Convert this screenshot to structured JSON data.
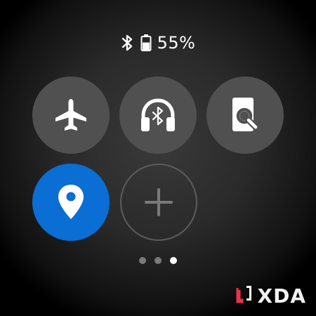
{
  "status": {
    "bluetooth_icon": "bluetooth-icon",
    "battery_icon": "battery-icon",
    "battery_level": 0.55,
    "battery_text": "55%"
  },
  "tiles": [
    {
      "name": "airplane-mode",
      "icon": "airplane-icon",
      "active": false
    },
    {
      "name": "earbuds",
      "icon": "bluetooth-headphones-icon",
      "active": false
    },
    {
      "name": "find-my-phone",
      "icon": "find-phone-icon",
      "active": false
    },
    {
      "name": "location",
      "icon": "location-pin-icon",
      "active": true
    },
    {
      "name": "add-tile",
      "icon": "plus-icon",
      "active": false
    }
  ],
  "pagination": {
    "pages": 3,
    "current": 3
  },
  "watermark": {
    "text": "XDA"
  },
  "colors": {
    "tile_bg": "#505050",
    "active_tile": "#0a6ed4",
    "accent_red": "#e8334a"
  }
}
